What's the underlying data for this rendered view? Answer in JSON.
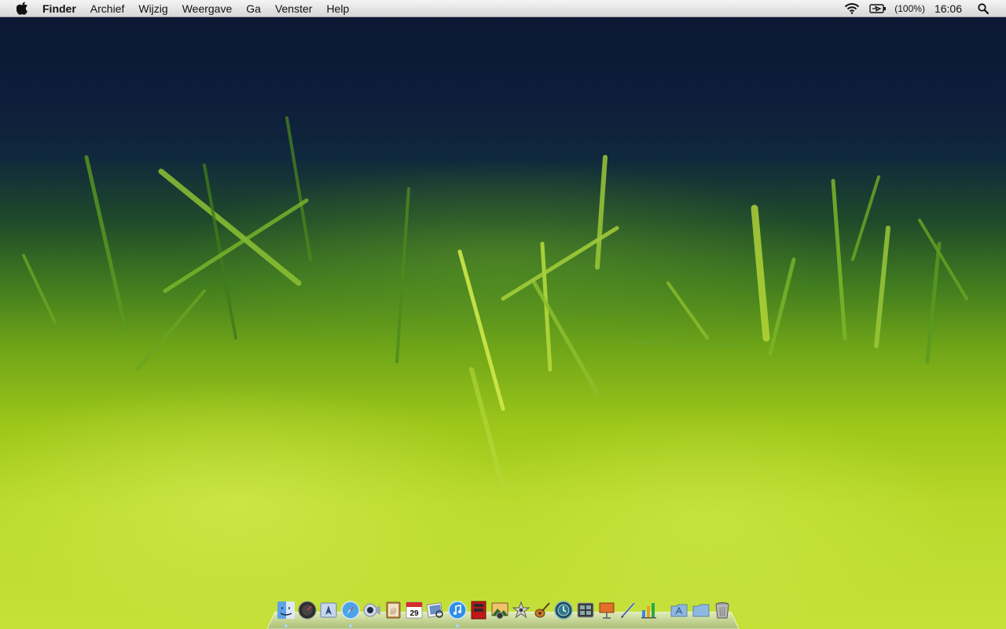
{
  "menubar": {
    "apple_icon": "apple-logo-icon",
    "app_name": "Finder",
    "items": [
      "Archief",
      "Wijzig",
      "Weergave",
      "Ga",
      "Venster",
      "Help"
    ],
    "status": {
      "wifi_icon": "wifi-icon",
      "battery_icon": "battery-charging-icon",
      "battery_text": "(100%)",
      "clock": "16:06",
      "search_icon": "spotlight-search-icon"
    }
  },
  "dock": {
    "apps": [
      {
        "name": "finder",
        "running": true
      },
      {
        "name": "dashboard",
        "running": false
      },
      {
        "name": "mail",
        "running": false
      },
      {
        "name": "safari",
        "running": true
      },
      {
        "name": "ichat",
        "running": false
      },
      {
        "name": "address-book",
        "running": false
      },
      {
        "name": "ical",
        "running": false,
        "label": "29"
      },
      {
        "name": "preview",
        "running": false
      },
      {
        "name": "itunes",
        "running": true
      },
      {
        "name": "photo-booth",
        "running": false
      },
      {
        "name": "iphoto",
        "running": false
      },
      {
        "name": "imovie",
        "running": false
      },
      {
        "name": "garageband",
        "running": false
      },
      {
        "name": "time-machine",
        "running": false
      },
      {
        "name": "spaces",
        "running": false
      },
      {
        "name": "keynote",
        "running": false
      },
      {
        "name": "pages",
        "running": false
      },
      {
        "name": "numbers",
        "running": false
      }
    ],
    "stacks": [
      {
        "name": "applications-folder"
      },
      {
        "name": "downloads-folder"
      },
      {
        "name": "trash"
      }
    ]
  }
}
